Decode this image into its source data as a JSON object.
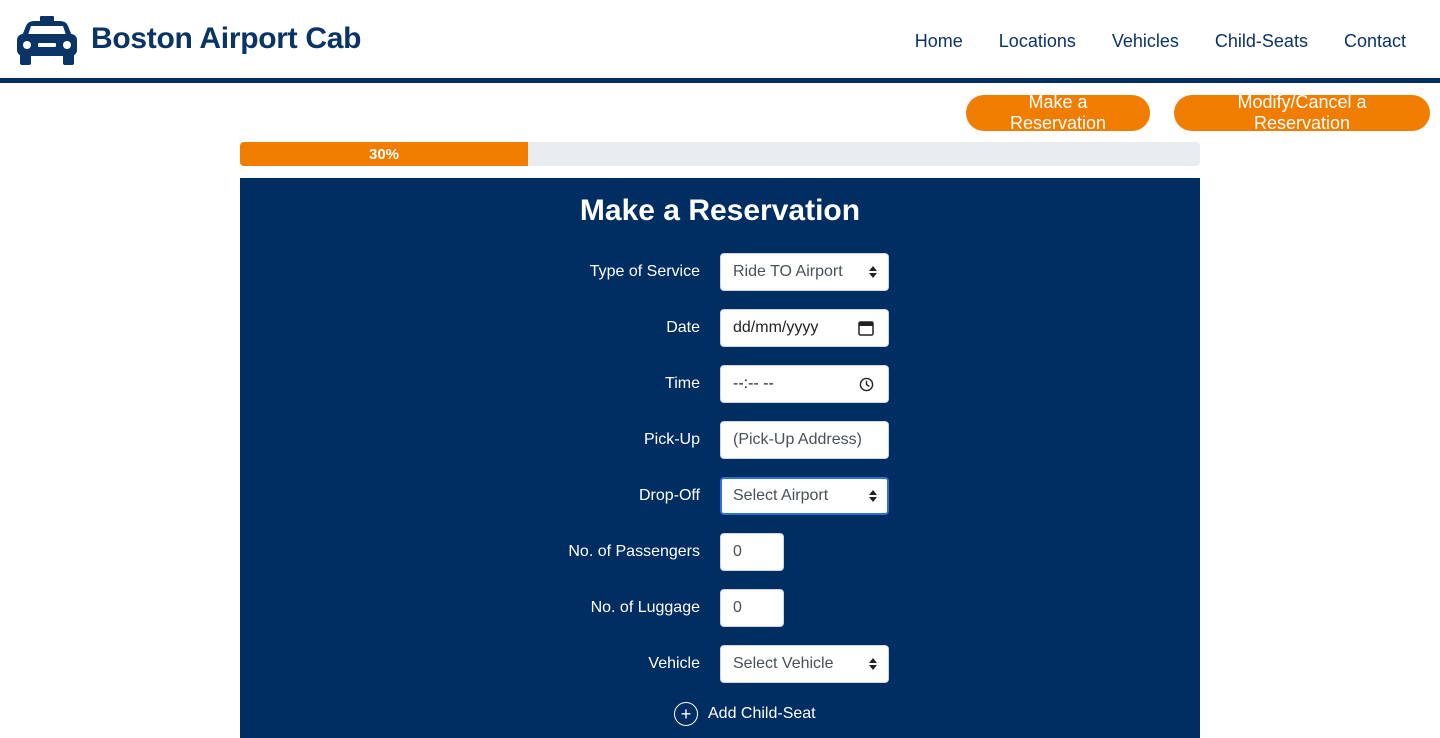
{
  "header": {
    "brand": "Boston Airport Cab",
    "logo_icon": "taxi-car-icon",
    "nav": [
      "Home",
      "Locations",
      "Vehicles",
      "Child-Seats",
      "Contact"
    ]
  },
  "actions": {
    "make": "Make a Reservation",
    "modify": "Modify/Cancel a Reservation"
  },
  "progress": {
    "value": 30,
    "label": "30%"
  },
  "form": {
    "title": "Make a Reservation",
    "service": {
      "label": "Type of Service",
      "value": "Ride TO Airport"
    },
    "date": {
      "label": "Date",
      "placeholder": "dd/mm/yyyy"
    },
    "time": {
      "label": "Time",
      "placeholder": "--:-- --"
    },
    "pickup": {
      "label": "Pick-Up",
      "placeholder": "(Pick-Up Address)"
    },
    "dropoff": {
      "label": "Drop-Off",
      "value": "Select Airport"
    },
    "passengers": {
      "label": "No. of Passengers",
      "value": "0"
    },
    "luggage": {
      "label": "No. of Luggage",
      "value": "0"
    },
    "vehicle": {
      "label": "Vehicle",
      "value": "Select Vehicle"
    },
    "add_seat": "Add Child-Seat"
  },
  "colors": {
    "navy": "#002d62",
    "orange": "#f07c00",
    "brand_text": "#0a3366"
  }
}
